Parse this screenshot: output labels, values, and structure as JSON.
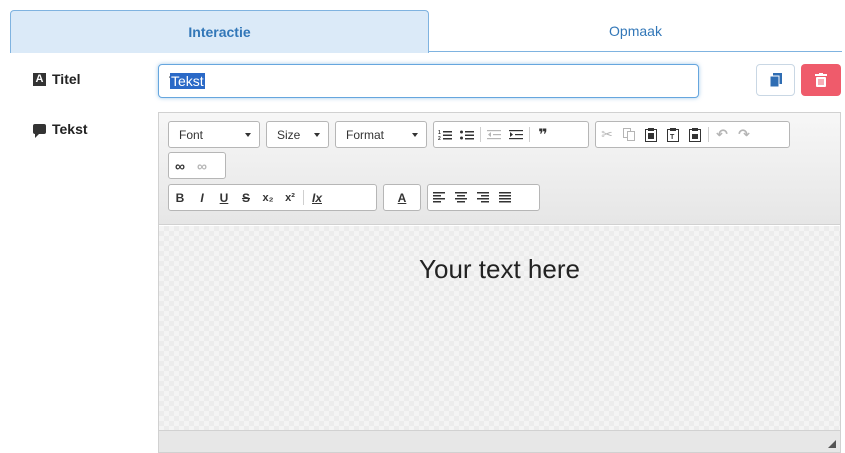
{
  "tabs": [
    {
      "label": "Interactie",
      "active": true
    },
    {
      "label": "Opmaak",
      "active": false
    }
  ],
  "fields": {
    "title_label": "Titel",
    "title_icon": "A",
    "title_value": "Tekst",
    "text_label": "Tekst"
  },
  "toolbar": {
    "font_combo": "Font",
    "size_combo": "Size",
    "format_combo": "Format",
    "list_buttons": [
      "numbered-list",
      "bulleted-list",
      "decrease-indent",
      "increase-indent",
      "blockquote"
    ],
    "clipboard_buttons": [
      "cut",
      "copy",
      "paste",
      "paste-text",
      "paste-word",
      "undo",
      "redo"
    ],
    "link_buttons": [
      "link",
      "unlink"
    ],
    "bold": "B",
    "italic": "I",
    "underline": "U",
    "strike": "S",
    "subscript": "x₂",
    "superscript": "x²",
    "remove_format": "Ix",
    "text_color": "A",
    "align_buttons": [
      "align-left",
      "align-center",
      "align-right",
      "justify"
    ]
  },
  "editor": {
    "content": "Your text here"
  },
  "colors": {
    "accent": "#3277b8",
    "danger": "#ef5b6b"
  }
}
